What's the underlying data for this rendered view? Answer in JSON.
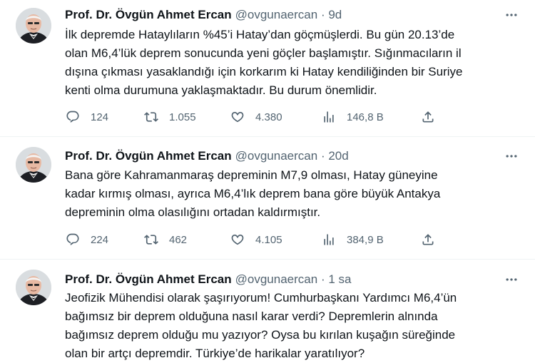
{
  "tweets": [
    {
      "name": "Prof. Dr. Övgün Ahmet Ercan",
      "handle": "@ovgunaercan",
      "separator": "·",
      "time": "9d",
      "lines": [
        "İlk depremde Hataylıların %45’i Hatay’dan göçmüşlerdi. Bu gün 20.13’de",
        "olan M6,4’lük deprem sonucunda yeni göçler başlamıştır. Sığınmacıların il",
        "dışına çıkması yasaklandığı için korkarım ki Hatay kendiliğinden bir Suriye",
        "kenti olma durumuna yaklaşmaktadır. Bu durum önemlidir."
      ],
      "replies": "124",
      "retweets": "1.055",
      "likes": "4.380",
      "views": "146,8 B"
    },
    {
      "name": "Prof. Dr. Övgün Ahmet Ercan",
      "handle": "@ovgunaercan",
      "separator": "·",
      "time": "20d",
      "lines": [
        "Bana göre Kahramanmaraş depreminin M7,9 olması, Hatay güneyine",
        "kadar kırmış olması, ayrıca M6,4’lık deprem bana göre büyük Antakya",
        "depreminin olma olasılığını ortadan kaldırmıştır."
      ],
      "replies": "224",
      "retweets": "462",
      "likes": "4.105",
      "views": "384,9 B"
    },
    {
      "name": "Prof. Dr. Övgün Ahmet Ercan",
      "handle": "@ovgunaercan",
      "separator": "·",
      "time": "1 sa",
      "lines": [
        "Jeofizik Mühendisi olarak şaşırıyorum! Cumhurbaşkanı Yardımcı M6,4’ün",
        "bağımsız bir deprem olduğuna nasıl karar verdi? Depremlerin alnında",
        "bağımsız deprem olduğu mu yazıyor? Oysa bu kırılan kuşağın süreğinde",
        "olan bir artçı depremdir. Türkiye’de harikalar yaratılıyor?"
      ]
    }
  ],
  "icons": {
    "reply": "reply-icon",
    "retweet": "retweet-icon",
    "like": "like-icon",
    "views": "views-icon",
    "share": "share-icon",
    "more": "more-icon"
  },
  "colors": {
    "text": "#0f1419",
    "secondary": "#536471",
    "divider": "#eff3f4"
  }
}
